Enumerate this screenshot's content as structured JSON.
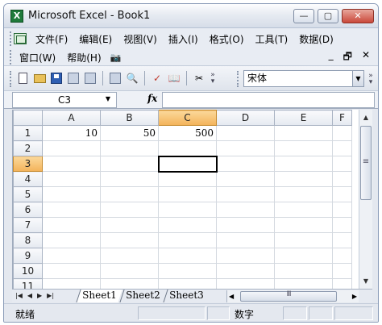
{
  "window": {
    "title": "Microsoft Excel - Book1"
  },
  "menu": {
    "row1": [
      "文件(F)",
      "编辑(E)",
      "视图(V)",
      "插入(I)",
      "格式(O)",
      "工具(T)",
      "数据(D)"
    ],
    "row2": [
      "窗口(W)",
      "帮助(H)"
    ]
  },
  "toolbar": {
    "font_name": "宋体"
  },
  "formula_bar": {
    "name_box": "C3",
    "fx_label": "fx",
    "formula": ""
  },
  "grid": {
    "columns": [
      "A",
      "B",
      "C",
      "D",
      "E",
      "F"
    ],
    "rows": [
      "1",
      "2",
      "3",
      "4",
      "5",
      "6",
      "7",
      "8",
      "9",
      "10",
      "11"
    ],
    "active_cell": "C3",
    "cells": {
      "A1": "10",
      "B1": "50",
      "C1": "500"
    }
  },
  "sheets": [
    "Sheet1",
    "Sheet2",
    "Sheet3"
  ],
  "active_sheet": "Sheet1",
  "status": {
    "ready": "就绪",
    "num": "数字"
  },
  "colors": {
    "active_header": "#f3b35a",
    "title_gradient_top": "#fdfdfe",
    "grid_line": "#d4d9e0"
  }
}
